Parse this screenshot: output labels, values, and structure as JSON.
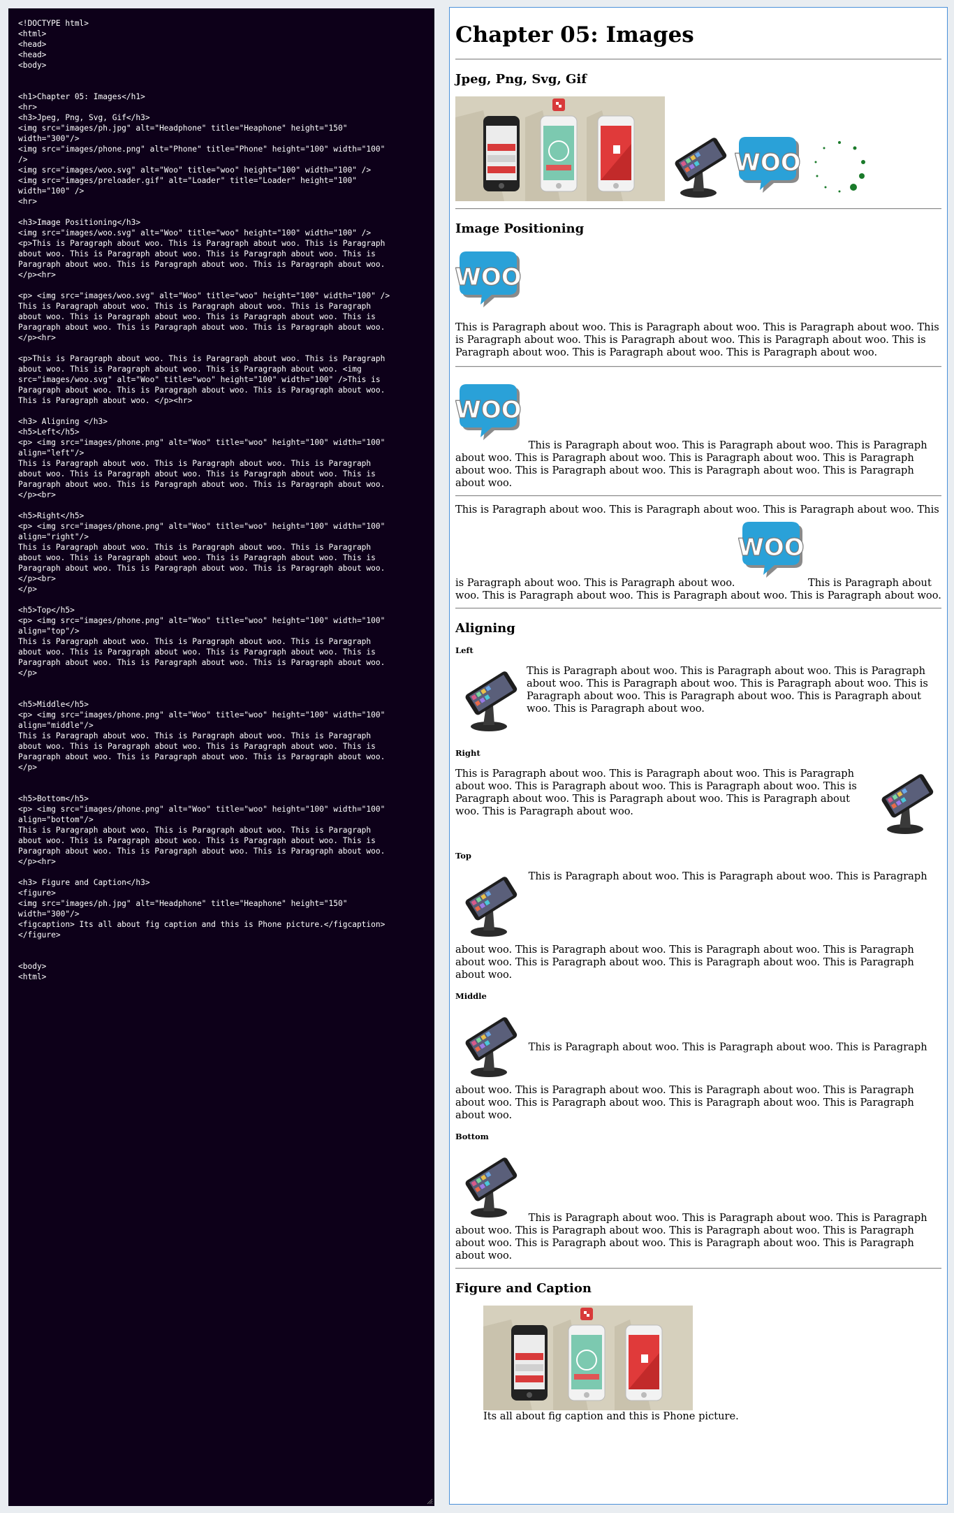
{
  "editor": {
    "lines": [
      "<!DOCTYPE html>",
      "<html>",
      "<head>",
      "<head>",
      "<body>",
      "",
      "",
      "<h1>Chapter 05: Images</h1>",
      "<hr>",
      "<h3>Jpeg, Png, Svg, Gif</h3>",
      "<img src=\"images/ph.jpg\" alt=\"Headphone\" title=\"Heaphone\" height=\"150\"",
      "width=\"300\"/>",
      "<img src=\"images/phone.png\" alt=\"Phone\" title=\"Phone\" height=\"100\" width=\"100\"",
      "/>",
      "<img src=\"images/woo.svg\" alt=\"Woo\" title=\"woo\" height=\"100\" width=\"100\" />",
      "<img src=\"images/preloader.gif\" alt=\"Loader\" title=\"Loader\" height=\"100\"",
      "width=\"100\" />",
      "<hr>",
      "",
      "<h3>Image Positioning</h3>",
      "<img src=\"images/woo.svg\" alt=\"Woo\" title=\"woo\" height=\"100\" width=\"100\" />",
      "<p>This is Paragraph about woo. This is Paragraph about woo. This is Paragraph",
      "about woo. This is Paragraph about woo. This is Paragraph about woo. This is",
      "Paragraph about woo. This is Paragraph about woo. This is Paragraph about woo.",
      "</p><hr>",
      "",
      "<p> <img src=\"images/woo.svg\" alt=\"Woo\" title=\"woo\" height=\"100\" width=\"100\" />",
      "This is Paragraph about woo. This is Paragraph about woo. This is Paragraph",
      "about woo. This is Paragraph about woo. This is Paragraph about woo. This is",
      "Paragraph about woo. This is Paragraph about woo. This is Paragraph about woo.",
      "</p><hr>",
      "",
      "<p>This is Paragraph about woo. This is Paragraph about woo. This is Paragraph",
      "about woo. This is Paragraph about woo. This is Paragraph about woo. <img",
      "src=\"images/woo.svg\" alt=\"Woo\" title=\"woo\" height=\"100\" width=\"100\" />This is",
      "Paragraph about woo. This is Paragraph about woo. This is Paragraph about woo.",
      "This is Paragraph about woo. </p><hr>",
      "",
      "<h3> Aligning </h3>",
      "<h5>Left</h5>",
      "<p> <img src=\"images/phone.png\" alt=\"Woo\" title=\"woo\" height=\"100\" width=\"100\"",
      "align=\"left\"/>",
      "This is Paragraph about woo. This is Paragraph about woo. This is Paragraph",
      "about woo. This is Paragraph about woo. This is Paragraph about woo. This is",
      "Paragraph about woo. This is Paragraph about woo. This is Paragraph about woo.",
      "</p><br>",
      "",
      "<h5>Right</h5>",
      "<p> <img src=\"images/phone.png\" alt=\"Woo\" title=\"woo\" height=\"100\" width=\"100\"",
      "align=\"right\"/>",
      "This is Paragraph about woo. This is Paragraph about woo. This is Paragraph",
      "about woo. This is Paragraph about woo. This is Paragraph about woo. This is",
      "Paragraph about woo. This is Paragraph about woo. This is Paragraph about woo.",
      "</p><br>",
      "</p>",
      "",
      "<h5>Top</h5>",
      "<p> <img src=\"images/phone.png\" alt=\"Woo\" title=\"woo\" height=\"100\" width=\"100\"",
      "align=\"top\"/>",
      "This is Paragraph about woo. This is Paragraph about woo. This is Paragraph",
      "about woo. This is Paragraph about woo. This is Paragraph about woo. This is",
      "Paragraph about woo. This is Paragraph about woo. This is Paragraph about woo.",
      "</p>",
      "",
      "",
      "<h5>Middle</h5>",
      "<p> <img src=\"images/phone.png\" alt=\"Woo\" title=\"woo\" height=\"100\" width=\"100\"",
      "align=\"middle\"/>",
      "This is Paragraph about woo. This is Paragraph about woo. This is Paragraph",
      "about woo. This is Paragraph about woo. This is Paragraph about woo. This is",
      "Paragraph about woo. This is Paragraph about woo. This is Paragraph about woo.",
      "</p>",
      "",
      "",
      "<h5>Bottom</h5>",
      "<p> <img src=\"images/phone.png\" alt=\"Woo\" title=\"woo\" height=\"100\" width=\"100\"",
      "align=\"bottom\"/>",
      "This is Paragraph about woo. This is Paragraph about woo. This is Paragraph",
      "about woo. This is Paragraph about woo. This is Paragraph about woo. This is",
      "Paragraph about woo. This is Paragraph about woo. This is Paragraph about woo.",
      "</p><hr>",
      "",
      "<h3> Figure and Caption</h3>",
      "<figure>",
      "<img src=\"images/ph.jpg\" alt=\"Headphone\" title=\"Heaphone\" height=\"150\"",
      "width=\"300\"/>",
      "<figcaption> Its all about fig caption and this is Phone picture.</figcaption>",
      "</figure>",
      "",
      "",
      "<body>",
      "<html>"
    ]
  },
  "preview": {
    "h1": "Chapter 05: Images",
    "h3_formats": "Jpeg, Png, Svg, Gif",
    "h3_positioning": "Image Positioning",
    "h3_aligning": "Aligning",
    "h5_left": "Left",
    "h5_right": "Right",
    "h5_top": "Top",
    "h5_middle": "Middle",
    "h5_bottom": "Bottom",
    "h3_figure": "Figure and Caption",
    "para_3": "This is Paragraph about woo. This is Paragraph about woo. This is Paragraph about woo. This is Paragraph about woo. This is Paragraph about woo. This is Paragraph about woo. This is Paragraph about woo. This is Paragraph about woo. This is Paragraph about woo.",
    "para_3_split_a": "This is Paragraph about woo. This is Paragraph about woo. This is Paragraph about woo. This is Paragraph about woo. This is Paragraph about woo.",
    "para_3_split_b": "This is Paragraph about woo. This is Paragraph about woo. This is Paragraph about woo. This is Paragraph about woo.",
    "para_2": "This is Paragraph about woo. This is Paragraph about woo. This is Paragraph about woo. This is Paragraph about woo. This is Paragraph about woo. This is Paragraph about woo. This is Paragraph about woo. This is Paragraph about woo. This is Paragraph about woo.",
    "figcaption": "Its all about fig caption and this is Phone picture.",
    "img_alt": {
      "headphone": "Headphone",
      "phone": "Phone",
      "woo": "Woo",
      "loader": "Loader"
    },
    "woo_text": "WOO"
  },
  "colors": {
    "editor_bg": "#0d0019",
    "preview_border": "#4a90d9",
    "woo_blue": "#2aa1d8",
    "loader_green": "#1a7a2a",
    "page_bg": "#e9edf1"
  }
}
